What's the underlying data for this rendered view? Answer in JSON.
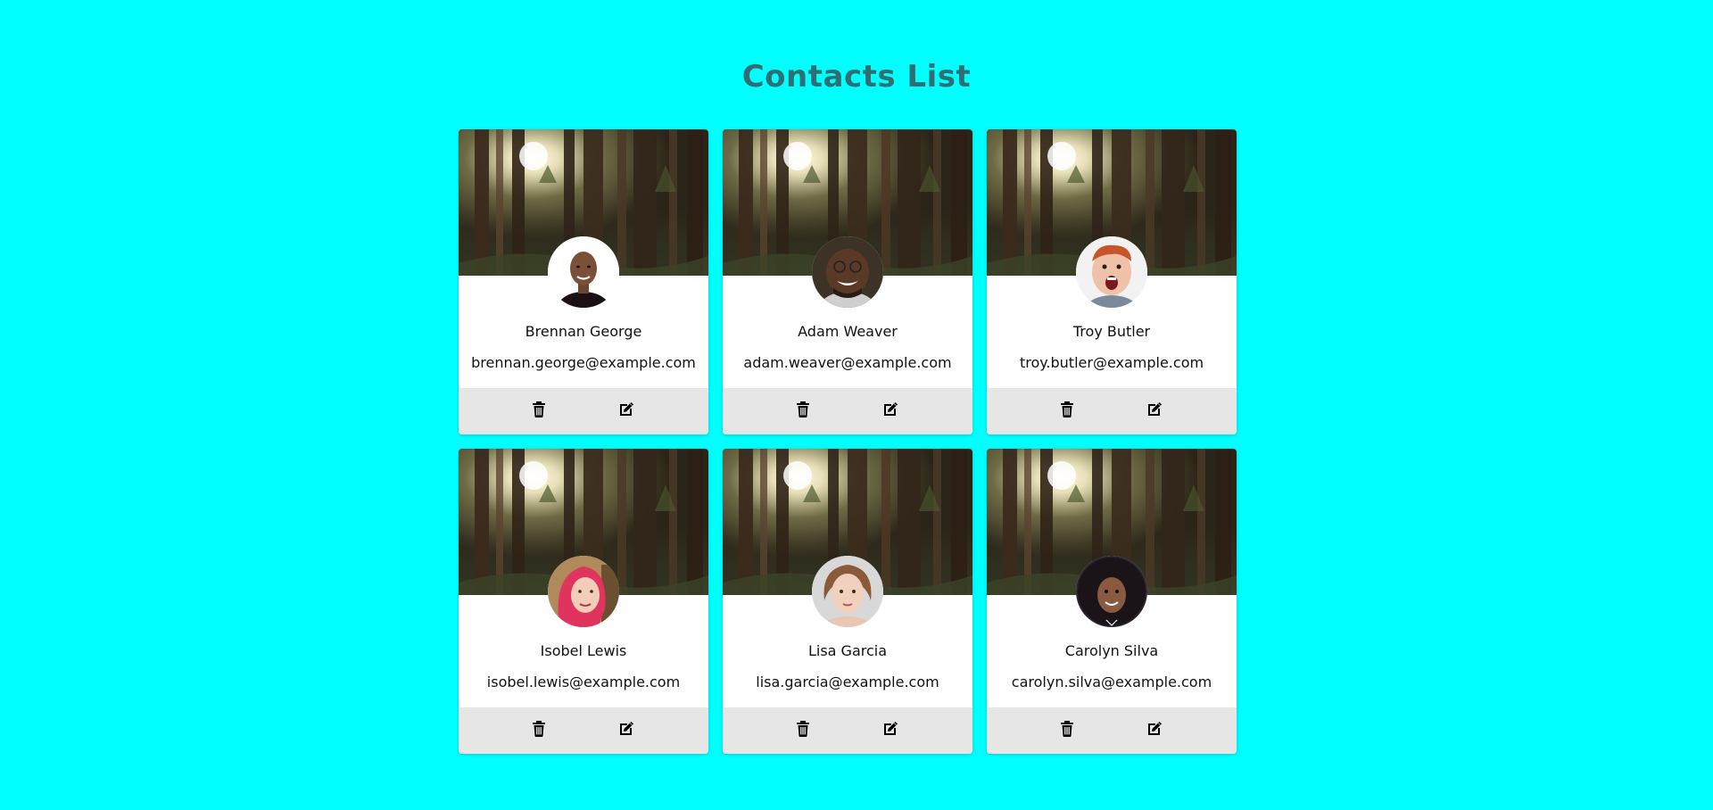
{
  "page_title": "Contacts List",
  "colors": {
    "background": "#00ffff",
    "title": "#2f6f73",
    "card": "#ffffff",
    "actions_bar": "#e6e6e6"
  },
  "contacts": [
    {
      "name": "Brennan George",
      "email": "brennan.george@example.com",
      "avatar_icon": "man-bald-avatar",
      "delete_icon": "trash-icon",
      "edit_icon": "edit-icon"
    },
    {
      "name": "Adam Weaver",
      "email": "adam.weaver@example.com",
      "avatar_icon": "man-glasses-avatar",
      "delete_icon": "trash-icon",
      "edit_icon": "edit-icon"
    },
    {
      "name": "Troy Butler",
      "email": "troy.butler@example.com",
      "avatar_icon": "man-redhair-avatar",
      "delete_icon": "trash-icon",
      "edit_icon": "edit-icon"
    },
    {
      "name": "Isobel Lewis",
      "email": "isobel.lewis@example.com",
      "avatar_icon": "woman-pinkhair-avatar",
      "delete_icon": "trash-icon",
      "edit_icon": "edit-icon"
    },
    {
      "name": "Lisa Garcia",
      "email": "lisa.garcia@example.com",
      "avatar_icon": "woman-brownhair-avatar",
      "delete_icon": "trash-icon",
      "edit_icon": "edit-icon"
    },
    {
      "name": "Carolyn Silva",
      "email": "carolyn.silva@example.com",
      "avatar_icon": "woman-curlyhair-avatar",
      "delete_icon": "trash-icon",
      "edit_icon": "edit-icon"
    }
  ]
}
